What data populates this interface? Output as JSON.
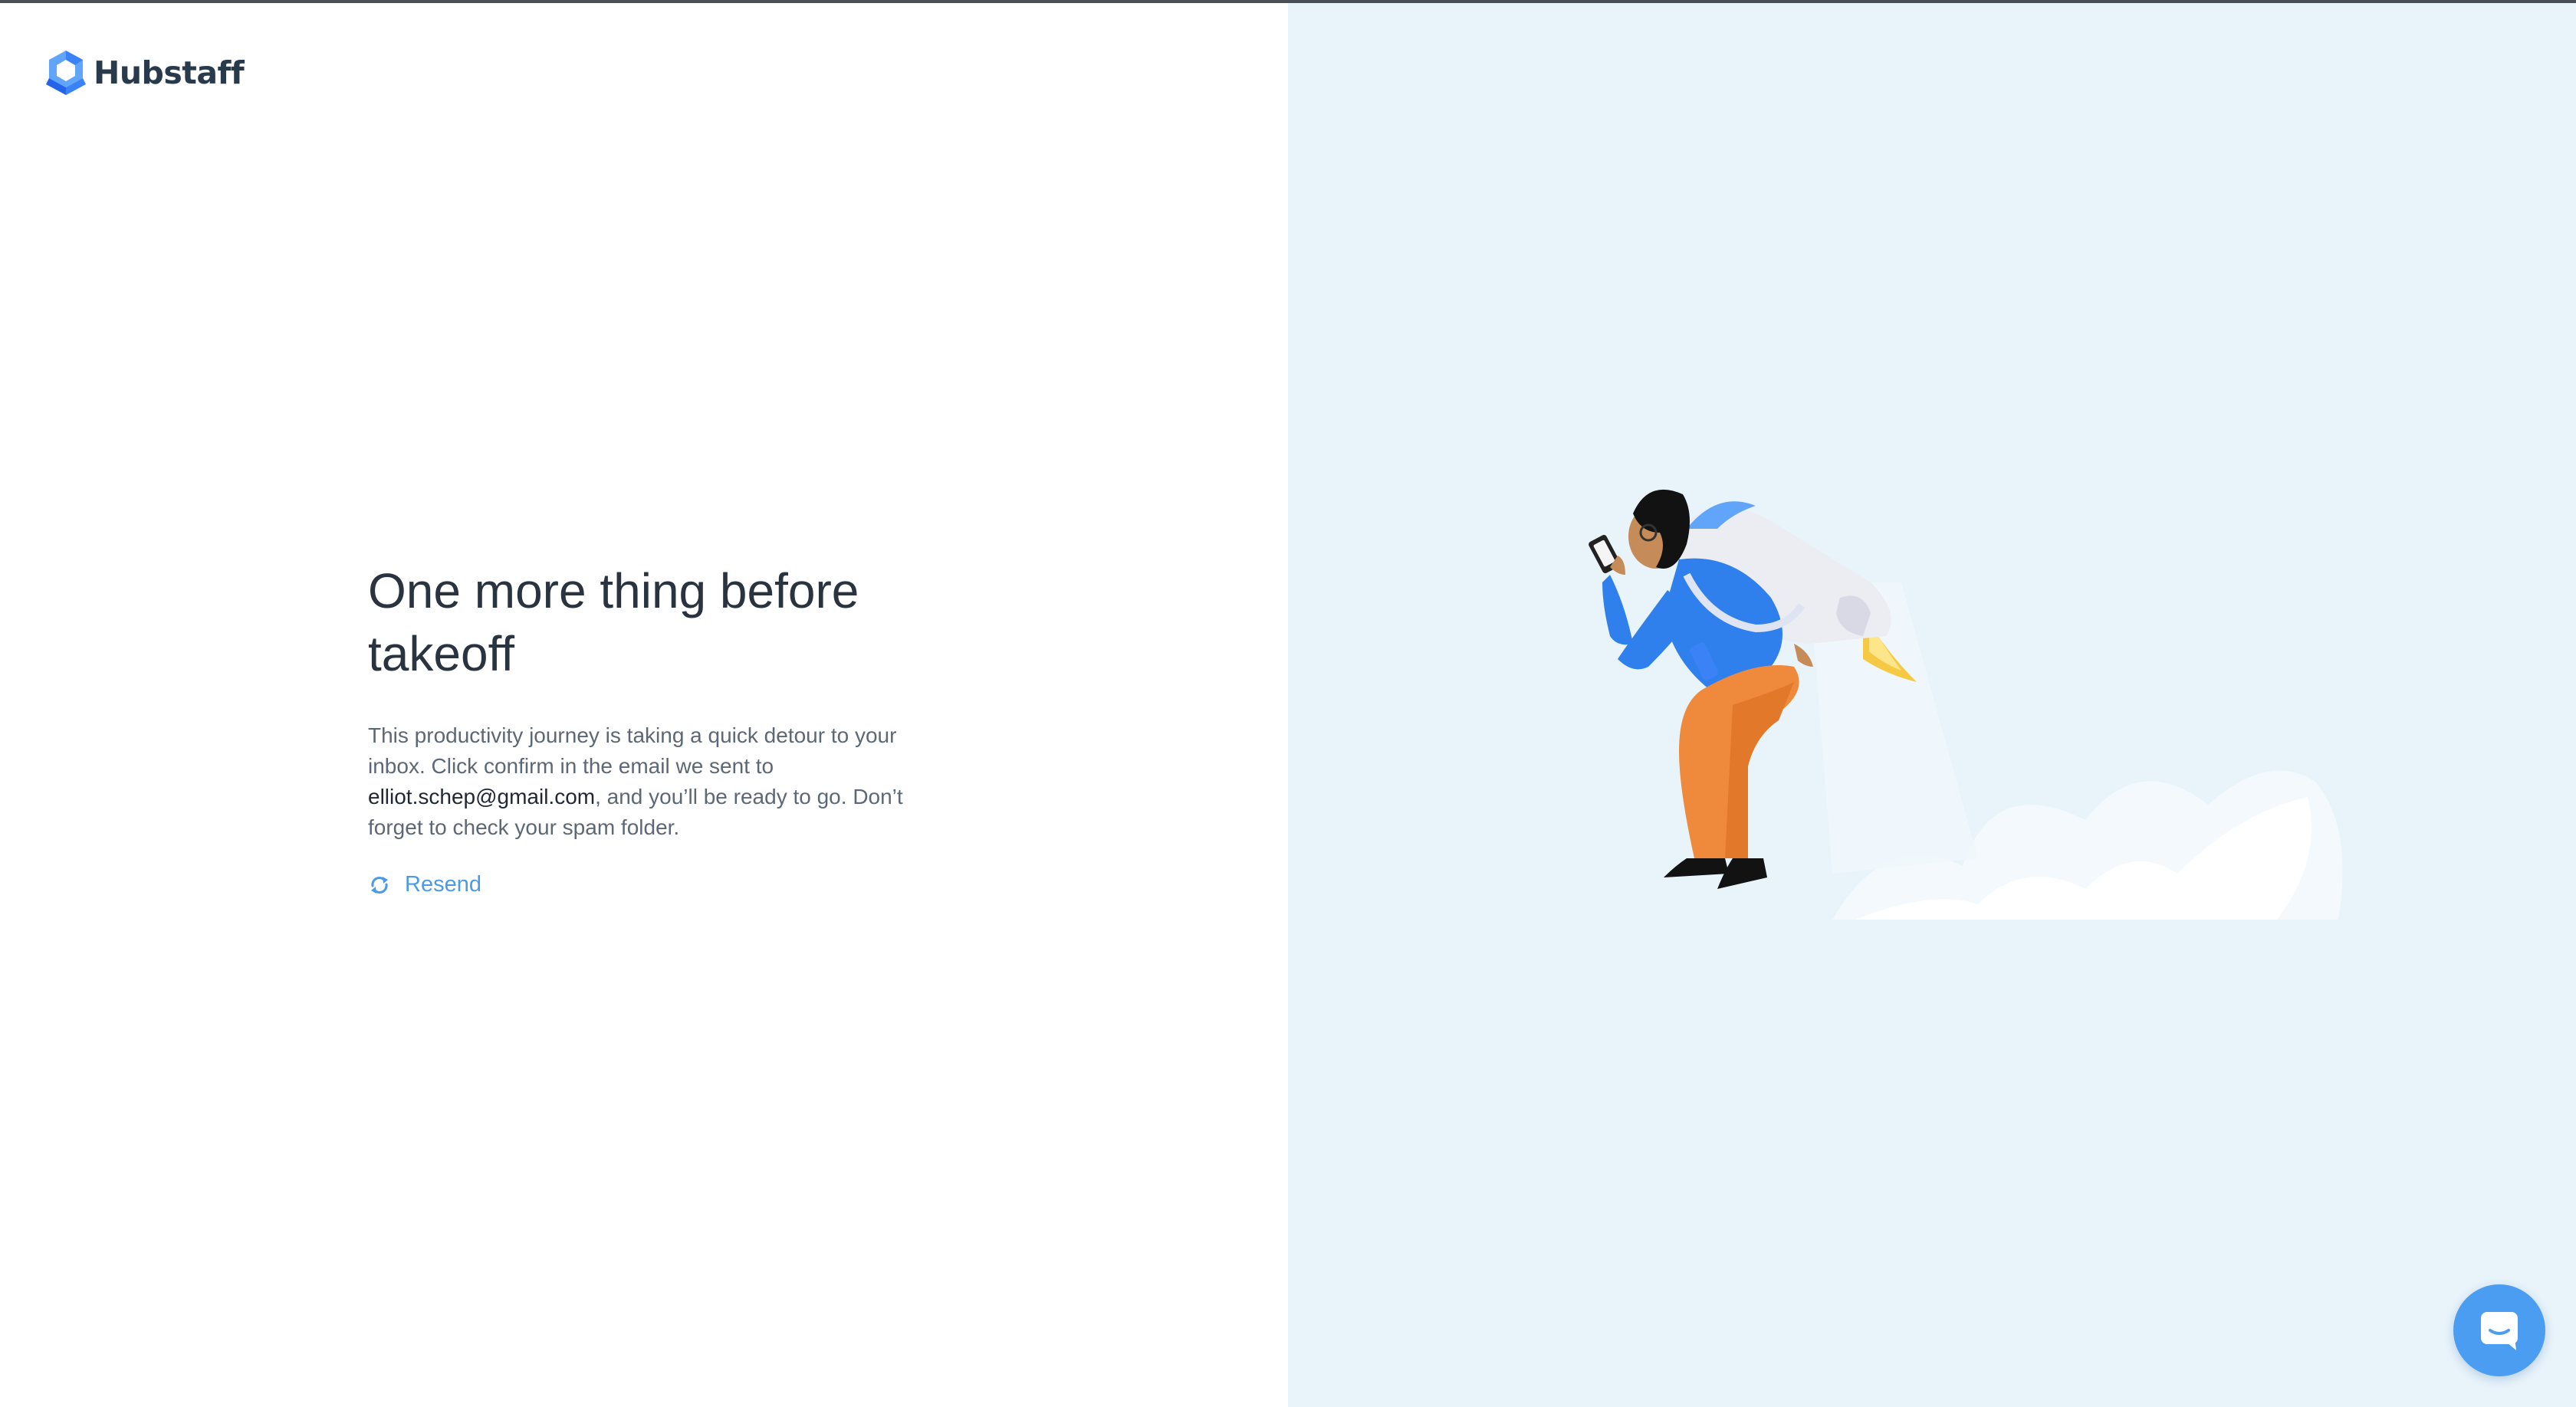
{
  "brand": {
    "name": "Hubstaff",
    "logo_icon": "hubstaff-logo-icon",
    "text_color": "#2a3a4d",
    "icon_colors": [
      "#3b82f6",
      "#60a5fa",
      "#2563eb"
    ]
  },
  "main": {
    "headline_line1": "One more thing before",
    "headline_line2": "takeoff",
    "body_part1": "This productivity journey is taking a quick detour to your inbox. Click confirm in the email we sent to ",
    "email": "elliot.schep@gmail.com",
    "body_part2": ", and you’ll be ready to go. Don’t forget to check your spam folder.",
    "resend_label": "Resend",
    "resend_icon": "refresh-icon"
  },
  "illustration": {
    "name": "jetpack-person-illustration",
    "background": "#e8f3fa"
  },
  "chat": {
    "icon": "chat-icon",
    "color": "#4a9df0"
  },
  "colors": {
    "accent": "#4a9ae6",
    "headline": "#2a3340",
    "body": "#5d6876"
  }
}
